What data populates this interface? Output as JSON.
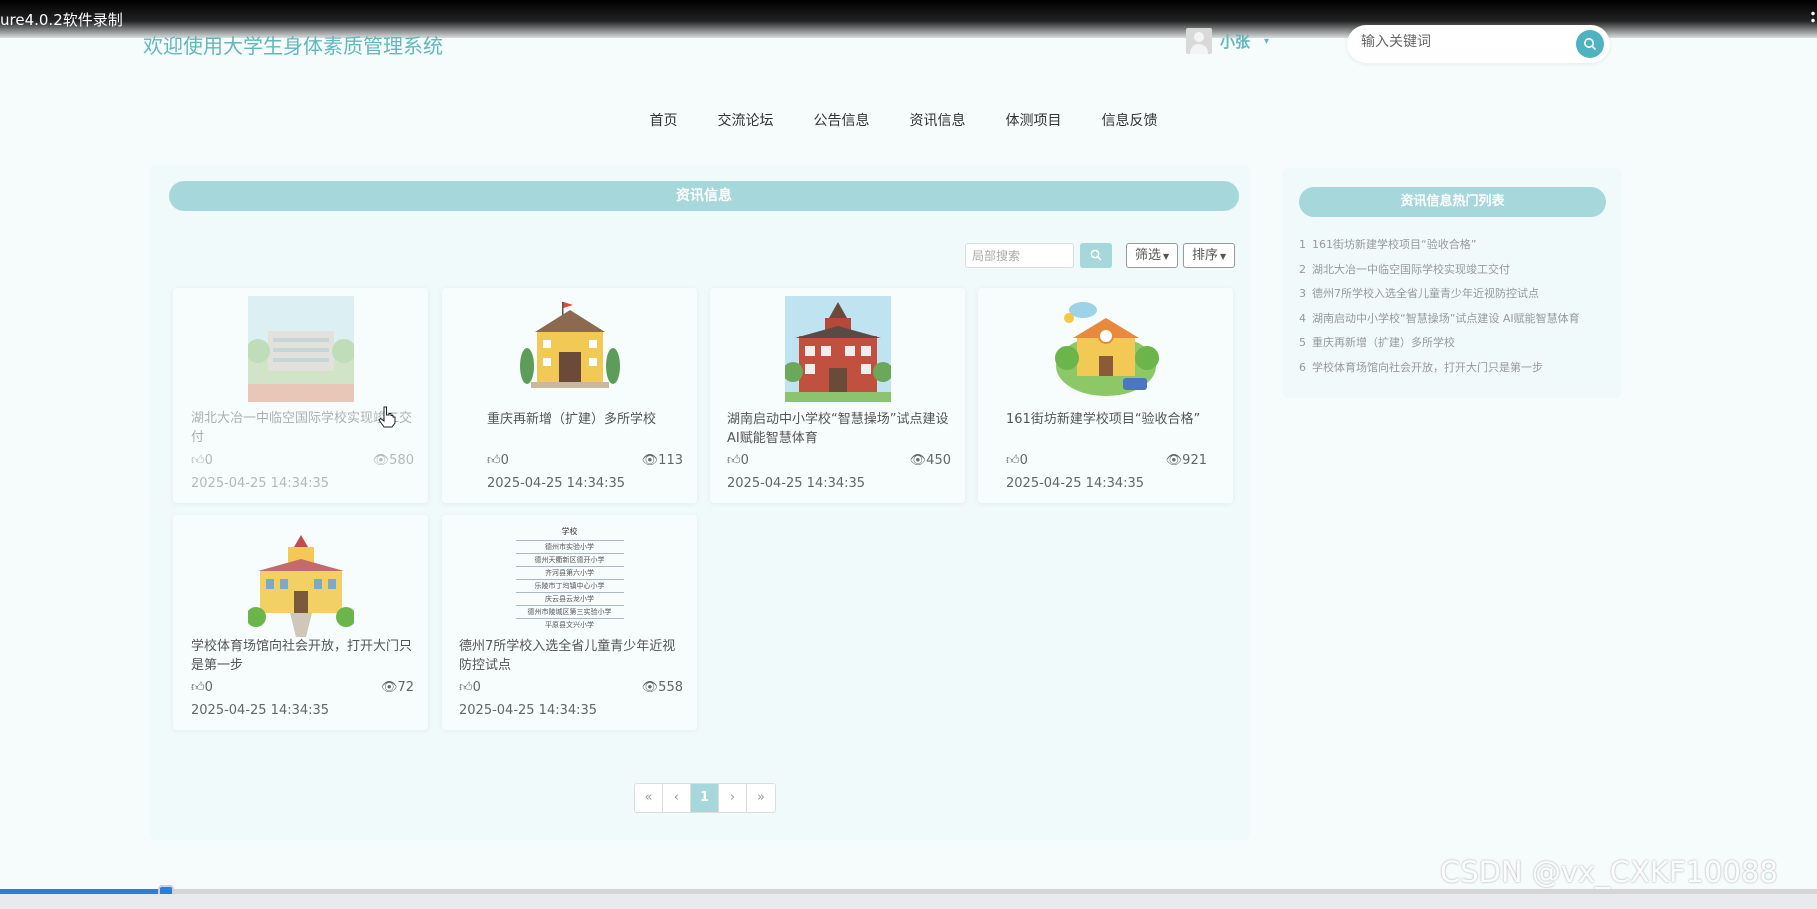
{
  "recorder": {
    "title": "ure4.0.2软件录制"
  },
  "header": {
    "site_title": "欢迎使用大学生身体素质管理系统",
    "user_name": "小张",
    "search_placeholder": "输入关键词"
  },
  "nav": {
    "items": [
      {
        "label": "首页"
      },
      {
        "label": "交流论坛"
      },
      {
        "label": "公告信息"
      },
      {
        "label": "资讯信息"
      },
      {
        "label": "体测项目"
      },
      {
        "label": "信息反馈"
      }
    ]
  },
  "main": {
    "heading": "资讯信息",
    "local_search_placeholder": "局部搜索",
    "filter_label": "筛选",
    "sort_label": "排序",
    "cards": [
      {
        "title": "湖北大冶一中临空国际学校实现竣工交付",
        "likes": "0",
        "views": "580",
        "date": "2025-04-25 14:34:35",
        "image": "school-photo"
      },
      {
        "title": "重庆再新增（扩建）多所学校",
        "likes": "0",
        "views": "113",
        "date": "2025-04-25 14:34:35",
        "image": "school-building-yellow"
      },
      {
        "title": "湖南启动中小学校“智慧操场”试点建设 AI赋能智慧体育",
        "likes": "0",
        "views": "450",
        "date": "2025-04-25 14:34:35",
        "image": "school-building-red"
      },
      {
        "title": "161街坊新建学校项目“验收合格”",
        "likes": "0",
        "views": "921",
        "date": "2025-04-25 14:34:35",
        "image": "school-cartoon"
      },
      {
        "title": "学校体育场馆向社会开放，打开大门只是第一步",
        "likes": "0",
        "views": "72",
        "date": "2025-04-25 14:34:35",
        "image": "school-building-pink"
      },
      {
        "title": "德州7所学校入选全省儿童青少年近视防控试点",
        "likes": "0",
        "views": "558",
        "date": "2025-04-25 14:34:35",
        "image": "school-name-list"
      }
    ],
    "school_list_image": {
      "heading": "学校",
      "rows": [
        "德州市实验小学",
        "德州天衢新区德开小学",
        "齐河县第六小学",
        "乐陵市丁坞镇中心小学",
        "庆云县云龙小学",
        "德州市陵城区第三实验小学",
        "平原县文兴小学"
      ]
    },
    "pagination": {
      "first": "«",
      "prev": "‹",
      "current": "1",
      "next": "›",
      "last": "»"
    }
  },
  "side": {
    "heading": "资讯信息热门列表",
    "items": [
      {
        "num": "1",
        "title": "161街坊新建学校项目“验收合格”"
      },
      {
        "num": "2",
        "title": "湖北大冶一中临空国际学校实现竣工交付"
      },
      {
        "num": "3",
        "title": "德州7所学校入选全省儿童青少年近视防控试点"
      },
      {
        "num": "4",
        "title": "湖南启动中小学校“智慧操场”试点建设 AI赋能智慧体育"
      },
      {
        "num": "5",
        "title": "重庆再新增（扩建）多所学校"
      },
      {
        "num": "6",
        "title": "学校体育场馆向社会开放，打开大门只是第一步"
      }
    ]
  },
  "watermark": "CSDN @vx_CXKF10088",
  "video": {
    "progress": 0.09
  },
  "colors": {
    "accent": "#a6d8db",
    "title_teal": "#62b7bc",
    "button_teal": "#4fb3bf"
  }
}
